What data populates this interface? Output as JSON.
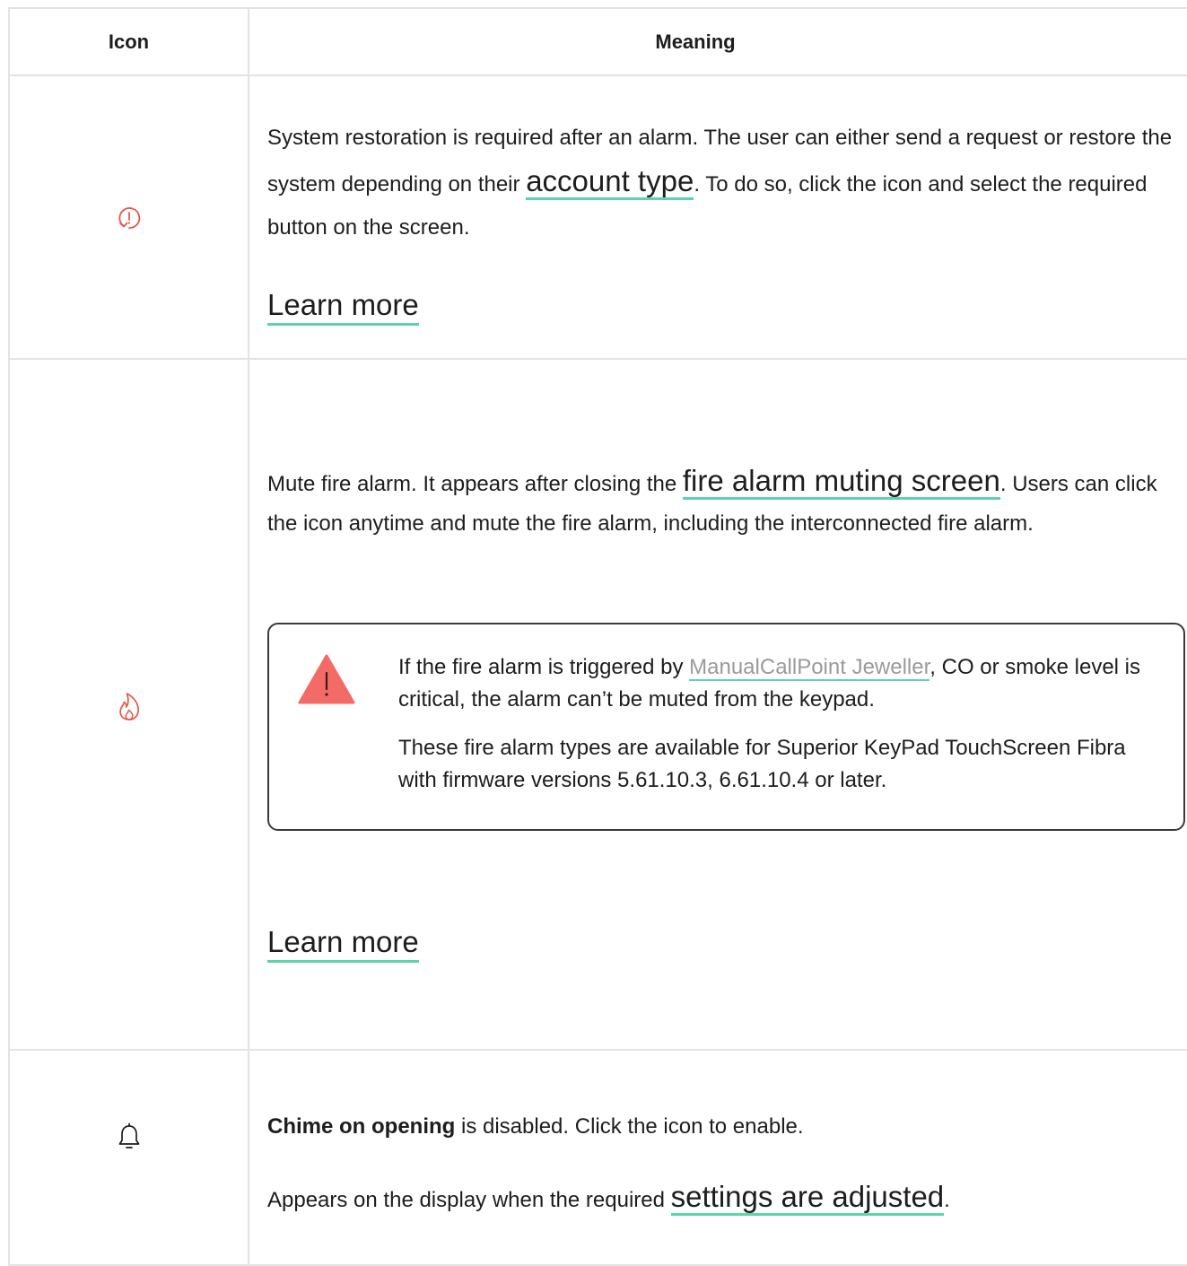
{
  "table": {
    "header_icon": "Icon",
    "header_meaning": "Meaning"
  },
  "rows": [
    {
      "icon": "system-restore-icon",
      "icon_color": "#e8544b",
      "text_before": "System restoration is required after an alarm. The user can either send a request or restore the system depending on their ",
      "link": "account type",
      "text_after": ". To do so, click the icon and select the required button on the screen.",
      "learn_more": "Learn more"
    },
    {
      "icon": "fire-icon",
      "icon_color": "#e8544b",
      "text_before": "Mute fire alarm. It appears after closing the ",
      "link": "fire alarm muting screen",
      "text_after": ". Users can click the icon anytime and mute the fire alarm, including the interconnected fire alarm.",
      "note": {
        "icon": "warning-icon",
        "icon_color": "#f26b66",
        "p1_before": "If the fire alarm is triggered by ",
        "p1_link": "ManualCallPoint Jeweller",
        "p1_after": ", CO or smoke level is critical, the alarm can’t be muted from the keypad.",
        "p2": "These fire alarm types are available for Superior KeyPad TouchScreen Fibra with firmware versions 5.61.10.3, 6.61.10.4 or later."
      },
      "learn_more": "Learn more"
    },
    {
      "icon": "bell-icon",
      "icon_color": "#1d1d1f",
      "bold": "Chime on opening",
      "text_after_bold": " is disabled. Click the icon to enable.",
      "text2_before": "Appears on the display when the required ",
      "link": "settings are adjusted",
      "text2_after": "."
    }
  ],
  "colors": {
    "accent_underline": "#5fd3a8",
    "border": "#e3e3e3"
  }
}
